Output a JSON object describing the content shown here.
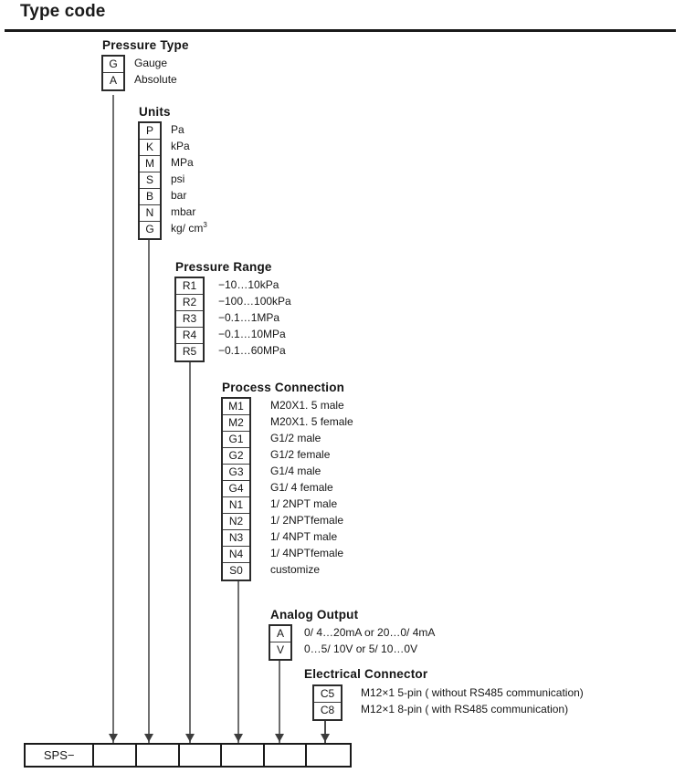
{
  "page": {
    "title": "Type code"
  },
  "groups": [
    {
      "id": "pressure-type",
      "title": "Pressure Type",
      "options": [
        {
          "code": "G",
          "desc": "Gauge"
        },
        {
          "code": "A",
          "desc": "Absolute"
        }
      ]
    },
    {
      "id": "units",
      "title": "Units",
      "options": [
        {
          "code": "P",
          "desc": "Pa"
        },
        {
          "code": "K",
          "desc": "kPa"
        },
        {
          "code": "M",
          "desc": "MPa"
        },
        {
          "code": "S",
          "desc": "psi"
        },
        {
          "code": "B",
          "desc": "bar"
        },
        {
          "code": "N",
          "desc": "mbar"
        },
        {
          "code": "G",
          "desc": "kg/ cm",
          "sup": "3"
        }
      ]
    },
    {
      "id": "pressure-range",
      "title": "Pressure Range",
      "options": [
        {
          "code": "R1",
          "desc": "−10…10kPa"
        },
        {
          "code": "R2",
          "desc": "−100…100kPa"
        },
        {
          "code": "R3",
          "desc": "−0.1…1MPa"
        },
        {
          "code": "R4",
          "desc": "−0.1…10MPa"
        },
        {
          "code": "R5",
          "desc": "−0.1…60MPa"
        }
      ]
    },
    {
      "id": "process-connection",
      "title": "Process Connection",
      "options": [
        {
          "code": "M1",
          "desc": "M20X1. 5 male"
        },
        {
          "code": "M2",
          "desc": "M20X1. 5 female"
        },
        {
          "code": "G1",
          "desc": "G1/2 male"
        },
        {
          "code": "G2",
          "desc": "G1/2 female"
        },
        {
          "code": "G3",
          "desc": "G1/4 male"
        },
        {
          "code": "G4",
          "desc": "G1/ 4 female"
        },
        {
          "code": "N1",
          "desc": "1/ 2NPT male"
        },
        {
          "code": "N2",
          "desc": "1/ 2NPTfemale"
        },
        {
          "code": "N3",
          "desc": "1/ 4NPT male"
        },
        {
          "code": "N4",
          "desc": "1/ 4NPTfemale"
        },
        {
          "code": "S0",
          "desc": "customize"
        }
      ]
    },
    {
      "id": "analog-output",
      "title": "Analog Output",
      "options": [
        {
          "code": "A",
          "desc": "0/ 4…20mA  or 20…0/ 4mA"
        },
        {
          "code": "V",
          "desc": "0…5/ 10V or  5/ 10…0V"
        }
      ]
    },
    {
      "id": "electrical-connector",
      "title": "Electrical Connector",
      "options": [
        {
          "code": "C5",
          "desc": "M12×1    5-pin ( without RS485 communication)"
        },
        {
          "code": "C8",
          "desc": "M12×1    8-pin ( with RS485 communication)"
        }
      ]
    }
  ],
  "result_bar": {
    "prefix": "SPS−",
    "slots": [
      "",
      "",
      "",
      "",
      "",
      ""
    ]
  },
  "colors": {
    "ink": "#1a1a1a",
    "box_border": "#2b2b2b",
    "connector": "#6f6f6f",
    "background": "#ffffff"
  }
}
